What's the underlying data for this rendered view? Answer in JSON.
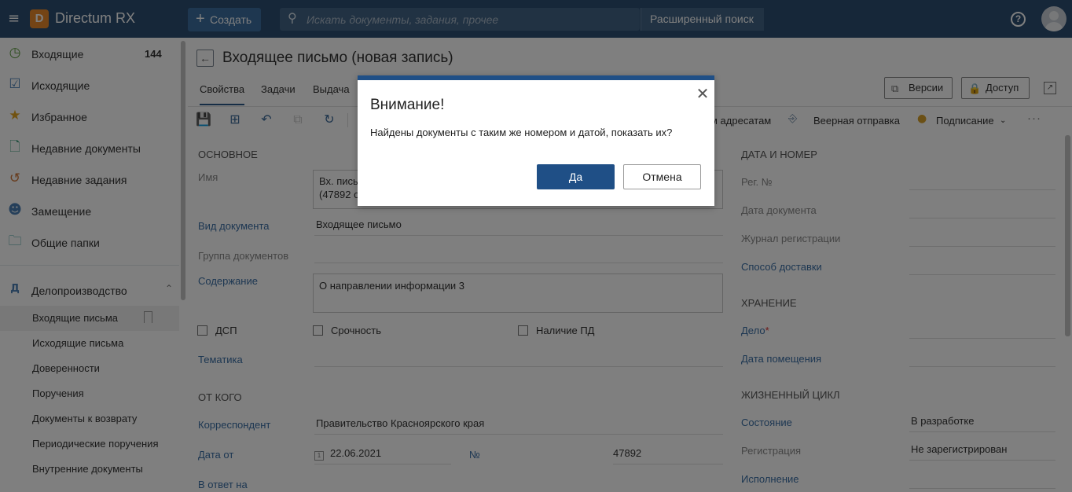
{
  "topbar": {
    "app_name": "Directum RX",
    "logo_letter": "D",
    "create_label": "Создать",
    "search_placeholder": "Искать документы, задания, прочее",
    "advanced_search_label": "Расширенный поиск",
    "help_label": "?"
  },
  "sidebar": {
    "items": [
      {
        "label": "Входящие",
        "count": "144",
        "icon": "clock-icon"
      },
      {
        "label": "Исходящие",
        "icon": "check-doc-icon"
      },
      {
        "label": "Избранное",
        "icon": "star-icon"
      },
      {
        "label": "Недавние документы",
        "icon": "doc-icon"
      },
      {
        "label": "Недавние задания",
        "icon": "history-icon"
      },
      {
        "label": "Замещение",
        "icon": "user-icon"
      },
      {
        "label": "Общие папки",
        "icon": "folder-icon"
      }
    ],
    "section": {
      "letter": "Д",
      "label": "Делопроизводство"
    },
    "sub_items": [
      "Входящие письма",
      "Исходящие письма",
      "Доверенности",
      "Поручения",
      "Документы к возврату",
      "Периодические поручения",
      "Внутренние документы"
    ]
  },
  "document": {
    "title": "Входящее письмо (новая запись)",
    "tabs": [
      "Свойства",
      "Задачи",
      "Выдача"
    ],
    "header_buttons": {
      "versions": "Версии",
      "access": "Доступ"
    },
    "toolbar": {
      "to_addressees": "м адресатам",
      "fan_send": "Веерная отправка",
      "signing": "Подписание",
      "more": "···"
    }
  },
  "form": {
    "main_section": "ОСНОВНОЕ",
    "name_label": "Имя",
    "name_value_line1": "Вх. пись",
    "name_value_line2": "(47892 о",
    "doc_kind_label": "Вид документа",
    "doc_kind_value": "Входящее письмо",
    "doc_group_label": "Группа документов",
    "content_label": "Содержание",
    "content_value": "О направлении информации 3",
    "dsp_label": "ДСП",
    "urgency_label": "Срочность",
    "pd_label": "Наличие ПД",
    "topic_label": "Тематика",
    "from_section": "ОТ КОГО",
    "correspondent_label": "Корреспондент",
    "correspondent_value": "Правительство Красноярского края",
    "date_from_label": "Дата от",
    "date_from_value": "22.06.2021",
    "number_label": "№",
    "number_value": "47892",
    "reply_to_label": "В ответ на"
  },
  "right_panel": {
    "date_number_section": "ДАТА И НОМЕР",
    "reg_no_label": "Рег. №",
    "doc_date_label": "Дата документа",
    "reg_journal_label": "Журнал регистрации",
    "delivery_label": "Способ доставки",
    "storage_section": "ХРАНЕНИЕ",
    "case_label": "Дело",
    "placement_date_label": "Дата помещения",
    "lifecycle_section": "ЖИЗНЕННЫЙ ЦИКЛ",
    "state_label": "Состояние",
    "state_value": "В разработке",
    "registration_label": "Регистрация",
    "registration_value": "Не зарегистрирован",
    "execution_label": "Исполнение"
  },
  "dialog": {
    "title": "Внимание!",
    "message": "Найдены документы с таким же номером и датой, показать их?",
    "yes_label": "Да",
    "cancel_label": "Отмена"
  },
  "colors": {
    "topbar": "#2d4e73",
    "accent": "#1f4f86",
    "logo": "#e8892b",
    "link": "#3a6ea5"
  }
}
